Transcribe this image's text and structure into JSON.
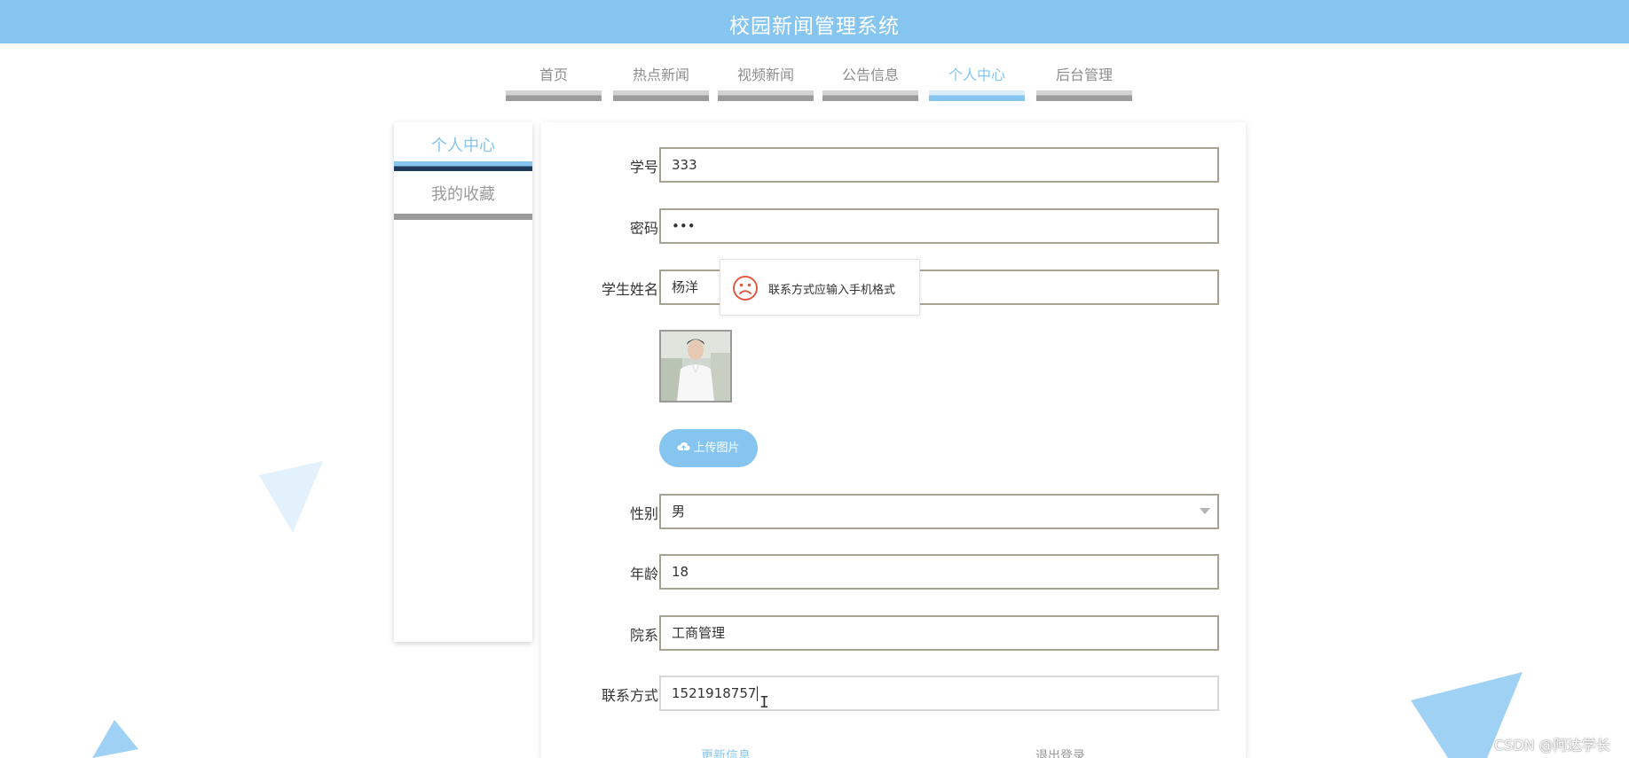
{
  "header": {
    "title": "校园新闻管理系统"
  },
  "nav": {
    "items": [
      {
        "label": "首页",
        "active": false
      },
      {
        "label": "热点新闻",
        "active": false
      },
      {
        "label": "视频新闻",
        "active": false
      },
      {
        "label": "公告信息",
        "active": false
      },
      {
        "label": "个人中心",
        "active": true
      },
      {
        "label": "后台管理",
        "active": false
      }
    ]
  },
  "sidebar": {
    "items": [
      {
        "label": "个人中心",
        "active": true
      },
      {
        "label": "我的收藏",
        "active": false
      }
    ]
  },
  "form": {
    "student_id": {
      "label": "学号",
      "value": "333"
    },
    "password": {
      "label": "密码",
      "value": "•••"
    },
    "name": {
      "label": "学生姓名",
      "value": "杨洋"
    },
    "upload_label": "上传图片",
    "gender": {
      "label": "性别",
      "value": "男"
    },
    "age": {
      "label": "年龄",
      "value": "18"
    },
    "department": {
      "label": "院系",
      "value": "工商管理"
    },
    "phone": {
      "label": "联系方式",
      "value": "1521918757"
    },
    "update_label": "更新信息",
    "logout_label": "退出登录"
  },
  "tooltip": {
    "message": "联系方式应输入手机格式",
    "icon": "sad-face-icon"
  },
  "watermark": "CSDN @阿达学长",
  "colors": {
    "accent": "#86c5f0",
    "error": "#e05a47",
    "field_border": "#a7a393"
  }
}
